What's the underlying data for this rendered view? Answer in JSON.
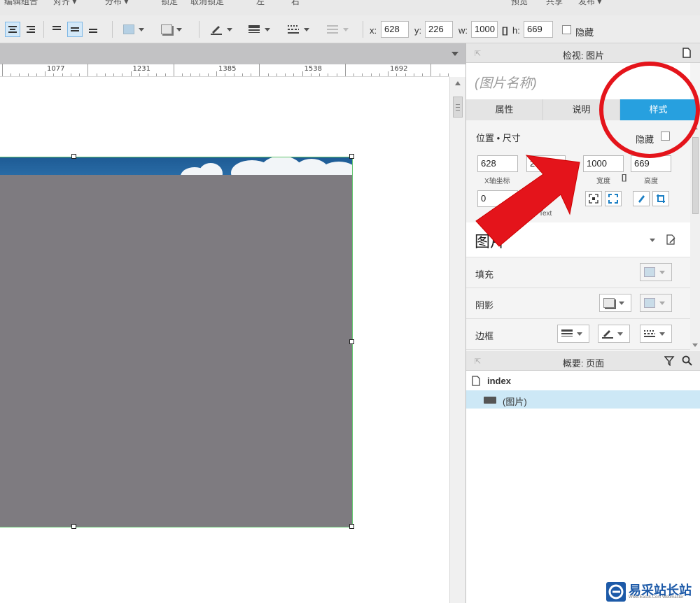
{
  "menu": {
    "items": [
      "编辑组合",
      "对齐 ▾",
      "分布 ▾",
      "锁定",
      "取消锁定",
      "左",
      "右",
      "预览",
      "共享",
      "发布 ▾"
    ]
  },
  "toolbar": {
    "x_label": "x:",
    "x_value": "628",
    "y_label": "y:",
    "y_value": "226",
    "w_label": "w:",
    "w_value": "1000",
    "h_label": "h:",
    "h_value": "669",
    "hide_label": "隐藏"
  },
  "ruler": {
    "labels": [
      "1077",
      "1231",
      "1385",
      "1538",
      "1692"
    ]
  },
  "inspector": {
    "title": "检视: 图片",
    "name_placeholder": "(图片名称)",
    "tabs": [
      "属性",
      "说明",
      "样式"
    ],
    "active_tab": "样式",
    "section_title": "位置 • 尺寸",
    "hide_label": "隐藏",
    "x_value": "628",
    "y_value_partial": "2",
    "width_value": "1000",
    "height_value": "669",
    "x_caption": "X轴坐标",
    "width_caption": "宽度",
    "height_caption": "高度",
    "rotation_value": "0",
    "text_caption": "Text",
    "style_name_partial": "图片",
    "rows": [
      "填充",
      "阴影",
      "边框"
    ]
  },
  "outline": {
    "title": "概要: 页面",
    "page": "index",
    "child": "(图片)"
  },
  "watermark": {
    "text": "易采站长站",
    "sub": "Www.Easck.Com  Webmaster"
  },
  "colors": {
    "accent": "#27a0df",
    "annotation_red": "#e4141b",
    "selection_green": "#5fc46b",
    "image_grey": "#7e7b80"
  }
}
